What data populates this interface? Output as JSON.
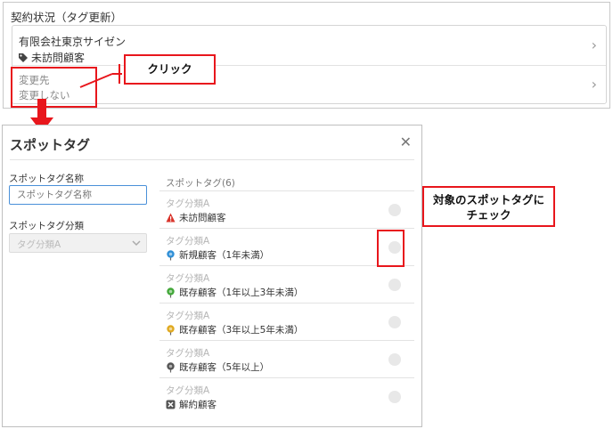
{
  "contract": {
    "title": "契約状況（タグ更新）",
    "company": "有限会社東京サイゼン",
    "current_tag": "未訪問顧客",
    "destination_label": "変更先",
    "destination_value": "変更しない",
    "chevron": "›"
  },
  "annotations": {
    "click_label": "クリック",
    "check_line1": "対象のスポットタグに",
    "check_line2": "チェック",
    "arrow_color": "#e8161c"
  },
  "modal": {
    "title": "スポットタグ",
    "close": "✕",
    "name_label": "スポットタグ名称",
    "name_placeholder": "スポットタグ名称",
    "category_label": "スポットタグ分類",
    "category_value": "タグ分類A",
    "list_header": "スポットタグ(6)",
    "tags": [
      {
        "category": "タグ分類A",
        "name": "未訪問顧客",
        "icon": "warning-icon",
        "color": "#d9342b"
      },
      {
        "category": "タグ分類A",
        "name": "新規顧客（1年未満）",
        "icon": "pin-icon",
        "color": "#2f8fd6"
      },
      {
        "category": "タグ分類A",
        "name": "既存顧客（1年以上3年未満）",
        "icon": "pin-icon",
        "color": "#43a83a"
      },
      {
        "category": "タグ分類A",
        "name": "既存顧客（3年以上5年未満）",
        "icon": "pin-icon",
        "color": "#e0a920"
      },
      {
        "category": "タグ分類A",
        "name": "既存顧客（5年以上）",
        "icon": "pin-icon",
        "color": "#555555"
      },
      {
        "category": "タグ分類A",
        "name": "解約顧客",
        "icon": "x-box-icon",
        "color": "#555555"
      }
    ]
  }
}
